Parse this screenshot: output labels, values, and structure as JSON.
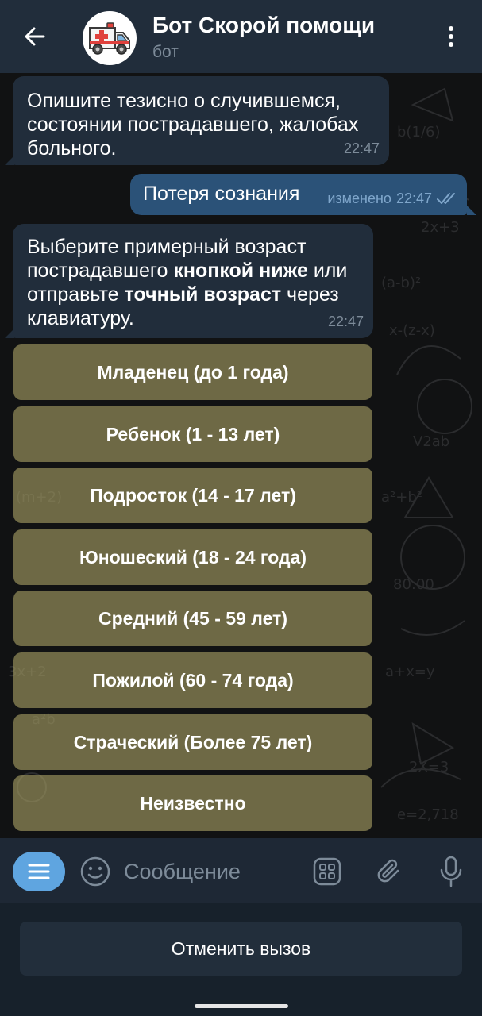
{
  "header": {
    "title": "Бот Скорой помощи",
    "subtitle": "бот",
    "back_icon": "arrow-left-icon",
    "menu_icon": "more-vertical-icon",
    "avatar_icon": "ambulance-icon"
  },
  "messages": [
    {
      "direction": "incoming",
      "text": "Опишите тезисно о случившемся, состоянии пострадавшего, жалобах больного.",
      "time": "22:47"
    },
    {
      "direction": "outgoing",
      "text": "Потеря сознания",
      "edited_label": "изменено",
      "time": "22:47",
      "status_icon": "double-check-icon"
    },
    {
      "direction": "incoming",
      "text_parts": {
        "p1": "Выберите примерный возраст пострадавшего ",
        "b1": "кнопкой ниже",
        "p2": " или отправьте ",
        "b2": "точный возраст",
        "p3": " через клавиатуру."
      },
      "time": "22:47"
    }
  ],
  "keyboard_buttons": [
    "Младенец (до 1 года)",
    "Ребенок (1 - 13 лет)",
    "Подросток (14 - 17 лет)",
    "Юношеский (18 - 24 года)",
    "Средний (45 - 59 лет)",
    "Пожилой (60 - 74 года)",
    "Страческий (Более 75 лет)",
    "Неизвестно"
  ],
  "input_bar": {
    "placeholder": "Сообщение",
    "menu_icon": "bot-menu-icon",
    "emoji_icon": "emoji-icon",
    "keyboard_icon": "bot-keyboard-icon",
    "attach_icon": "paperclip-icon",
    "mic_icon": "microphone-icon"
  },
  "bottom_panel": {
    "cancel_label": "Отменить вызов"
  },
  "colors": {
    "header_bg": "#212d3b",
    "incoming_bubble": "#212d3b",
    "outgoing_bubble": "#2b5278",
    "keyboard_button": "#8a845a",
    "accent": "#5fa5e0"
  }
}
